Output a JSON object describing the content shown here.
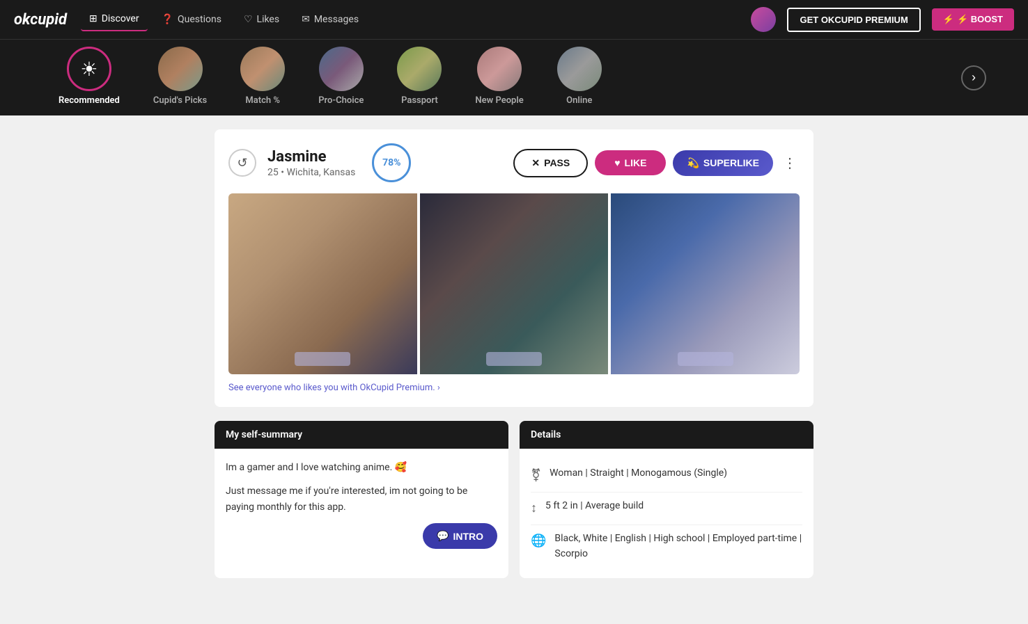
{
  "logo": "okcupid",
  "nav": {
    "items": [
      {
        "label": "Discover",
        "icon": "⊞",
        "active": true
      },
      {
        "label": "Questions",
        "icon": "?"
      },
      {
        "label": "Likes",
        "icon": "♡"
      },
      {
        "label": "Messages",
        "icon": "✉"
      }
    ],
    "premium_btn": "GET OKCUPID PREMIUM",
    "boost_btn": "⚡ BOOST"
  },
  "categories": [
    {
      "label": "Recommended",
      "type": "recommended",
      "active": true
    },
    {
      "label": "Cupid's Picks",
      "type": "blur-bg"
    },
    {
      "label": "Match %",
      "type": "blur-bg2"
    },
    {
      "label": "Pro-Choice",
      "type": "blur-bg3"
    },
    {
      "label": "Passport",
      "type": "blur-bg4"
    },
    {
      "label": "New People",
      "type": "blur-bg5"
    },
    {
      "label": "Online",
      "type": "blur-bg6"
    }
  ],
  "profile": {
    "name": "Jasmine",
    "age": "25",
    "location": "Wichita, Kansas",
    "match_pct": "78%",
    "pass_label": "PASS",
    "like_label": "LIKE",
    "superlike_label": "SUPERLIKE",
    "premium_link": "See everyone who likes you with OkCupid Premium. ›",
    "summary_header": "My self-summary",
    "summary_text1": "Im a gamer and I love watching anime. 🥰",
    "summary_text2": "Just message me if you're interested, im not going to be paying monthly for this app.",
    "intro_label": "INTRO",
    "details_header": "Details",
    "details": [
      {
        "icon": "⚧",
        "text": "Woman | Straight | Monogamous (Single)"
      },
      {
        "icon": "↕",
        "text": "5 ft 2 in | Average build"
      },
      {
        "icon": "🌐",
        "text": "Black, White | English | High school | Employed part-time | Scorpio"
      }
    ]
  }
}
